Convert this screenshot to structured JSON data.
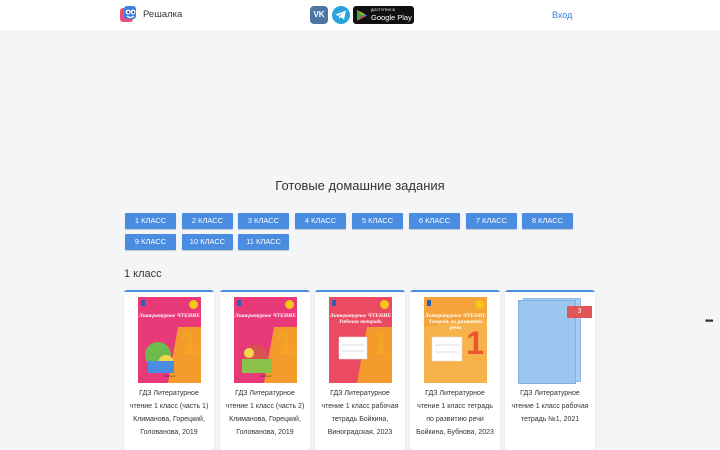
{
  "header": {
    "brand": "Решалка",
    "vk_label": "VK",
    "gplay_small": "ДОСТУПНО В",
    "gplay_big": "Google Play",
    "login": "Вход"
  },
  "main": {
    "title": "Готовые домашние задания",
    "grades": [
      "1 КЛАСС",
      "2 КЛАСС",
      "3 КЛАСС",
      "4 КЛАСС",
      "5 КЛАСС",
      "6 КЛАСС",
      "7 КЛАСС",
      "8 КЛАСС",
      "9 КЛАСС",
      "10 КЛАСС",
      "11 КЛАСС"
    ],
    "section_title": "1 класс",
    "books": [
      {
        "cover_title": "Литературное ЧТЕНИЕ",
        "cover_num": "1",
        "cover_part": "Часть 1",
        "text": "ГДЗ Литературное чтение 1 класс (часть 1) Климанова, Горецкий, Голованова, 2019"
      },
      {
        "cover_title": "Литературное ЧТЕНИЕ",
        "cover_num": "1",
        "cover_part": "Часть 2",
        "text": "ГДЗ Литературное чтение 1 класс (часть 2) Климанова, Горецкий, Голованова, 2019"
      },
      {
        "cover_title": "Литературное ЧТЕНИЕ Рабочая тетрадь",
        "cover_num": "1",
        "cover_part": "",
        "text": "ГДЗ Литературное чтение 1 класс рабочая тетрадь Бойкина, Виноградская, 2023"
      },
      {
        "cover_title": "Литературное ЧТЕНИЕ Тетрадь по развитию речи",
        "cover_num": "1",
        "cover_part": "",
        "text": "ГДЗ Литературное чтение 1 класс тетрадь по развитию речи Бойкина, Бубнова, 2023"
      },
      {
        "text": "ГДЗ Литературное чтение 1 класс рабочая тетрадь №1, 2021",
        "badge": "3"
      }
    ],
    "more": "•••"
  },
  "colors": {
    "accent": "#4a8de0",
    "badge": "#e25555",
    "cover_pink": "#e83a78",
    "cover_orange": "#f39b2d",
    "cover_red": "#ea4b62",
    "cover_light_orange": "#f7b24b"
  }
}
